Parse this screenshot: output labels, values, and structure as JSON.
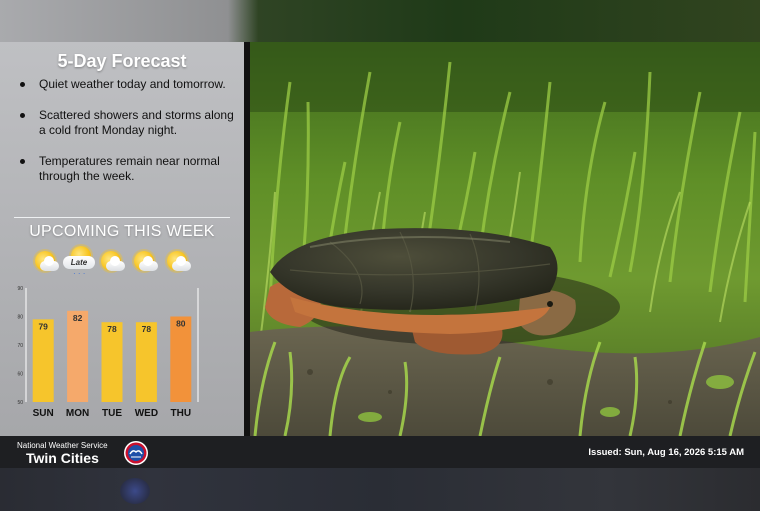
{
  "forecast": {
    "title": "5-Day Forecast",
    "bullets": [
      "Quiet weather today and tomorrow.",
      "Scattered showers and storms along a cold front Monday night.",
      "Temperatures remain near normal through the week."
    ],
    "upcoming_label": "UPCOMING THIS WEEK",
    "late_label": "Late",
    "icons": [
      "partly-sunny-icon",
      "partly-sunny-late-rain-icon",
      "partly-sunny-icon",
      "partly-sunny-icon",
      "partly-sunny-icon"
    ],
    "colors": {
      "bar_yellow": "#f6c52c",
      "bar_peach": "#f5a96b",
      "bar_orange": "#f2923a"
    }
  },
  "chart_data": {
    "type": "bar",
    "categories": [
      "SUN",
      "MON",
      "TUE",
      "WED",
      "THU"
    ],
    "values": [
      79,
      82,
      78,
      78,
      80
    ],
    "ylim": [
      50,
      90
    ],
    "yticks": [
      50,
      60,
      70,
      80,
      90
    ],
    "title": "",
    "xlabel": "",
    "ylabel": "",
    "bar_colors": [
      "#f6c52c",
      "#f5a96b",
      "#f6c52c",
      "#f6c52c",
      "#f2923a"
    ]
  },
  "footer": {
    "org": "National Weather Service",
    "office": "Twin Cities",
    "issued": "Issued: Sun, Aug 16, 2026 5:15 AM"
  },
  "photo": {
    "subject_icon": "snapping-turtle-in-grass"
  }
}
